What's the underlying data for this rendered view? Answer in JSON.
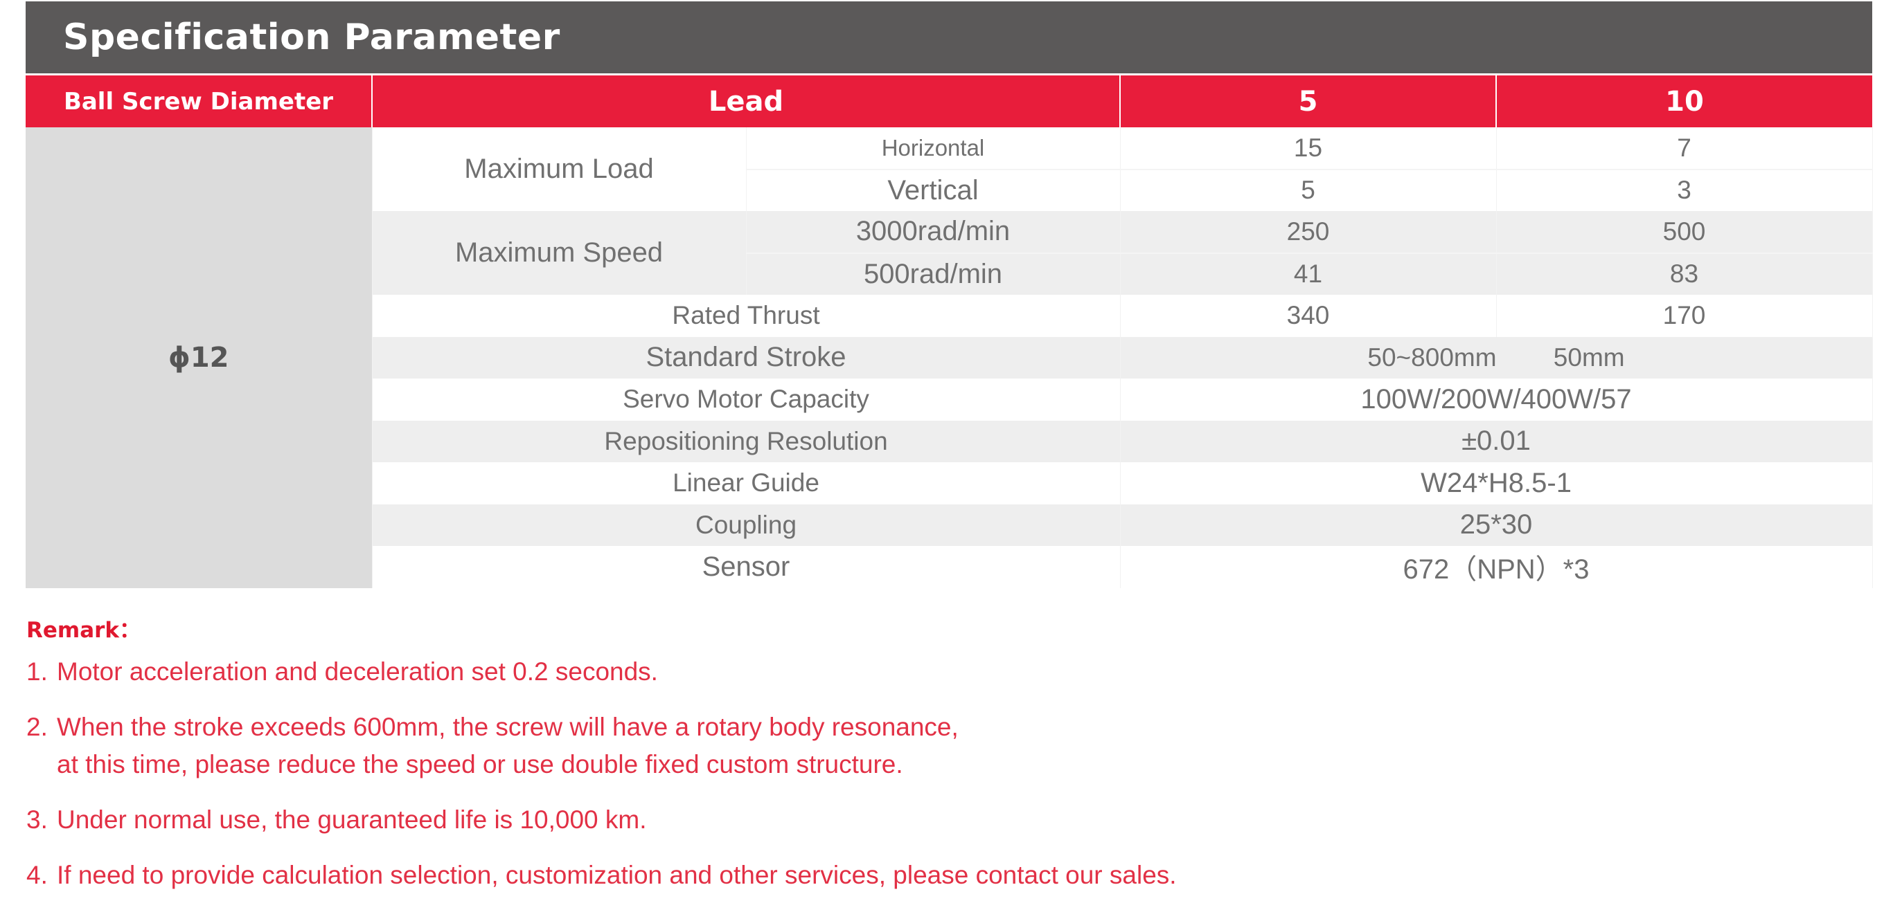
{
  "title": "Specification Parameter",
  "header": {
    "diameter_label": "Ball Screw Diameter",
    "lead_label": "Lead",
    "lead_values": [
      "5",
      "10"
    ]
  },
  "diameter_value": "ϕ12",
  "rows": {
    "max_load": {
      "label": "Maximum Load",
      "sub1": "Horizontal",
      "sub1_values": [
        "15",
        "7"
      ],
      "sub2": "Vertical",
      "sub2_values": [
        "5",
        "3"
      ]
    },
    "max_speed": {
      "label": "Maximum Speed",
      "sub1": "3000rad/min",
      "sub1_values": [
        "250",
        "500"
      ],
      "sub2": "500rad/min",
      "sub2_values": [
        "41",
        "83"
      ]
    },
    "rated_thrust": {
      "label": "Rated Thrust",
      "values": [
        "340",
        "170"
      ]
    },
    "standard_stroke": {
      "label": "Standard Stroke",
      "value": "50~800mm        50mm"
    },
    "servo_motor": {
      "label": "Servo Motor Capacity",
      "value": "100W/200W/400W/57"
    },
    "repositioning": {
      "label": "Repositioning Resolution",
      "value": "±0.01"
    },
    "linear_guide": {
      "label": "Linear Guide",
      "value": "W24*H8.5-1"
    },
    "coupling": {
      "label": "Coupling",
      "value": "25*30"
    },
    "sensor": {
      "label": "Sensor",
      "value": "672（NPN）*3"
    }
  },
  "remarks": {
    "title": "Remark：",
    "items": [
      {
        "num": "1.",
        "text": "Motor acceleration and deceleration set 0.2 seconds."
      },
      {
        "num": "2.",
        "text": "When the stroke exceeds 600mm, the screw will have a rotary body resonance,\nat this time, please reduce the speed or use double fixed custom structure."
      },
      {
        "num": "3.",
        "text": "Under normal use, the guaranteed life is 10,000 km."
      },
      {
        "num": "4.",
        "text": "If need to provide calculation selection, customization and other services, please contact our sales."
      }
    ]
  }
}
